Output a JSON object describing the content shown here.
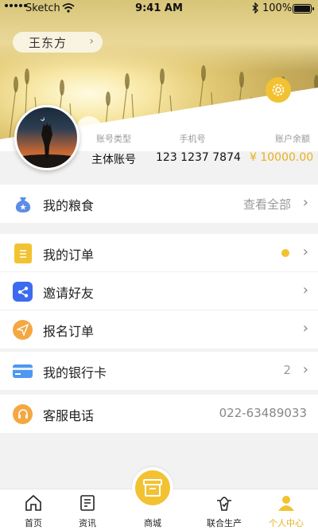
{
  "status_bar": {
    "carrier": "Sketch",
    "time": "9:41 AM",
    "battery": "100%"
  },
  "profile": {
    "name": "王东方"
  },
  "stats": [
    {
      "label": "账号类型",
      "value": "主体账号"
    },
    {
      "label": "手机号",
      "value": "123 1237 7874"
    },
    {
      "label": "账户余额",
      "value": "¥ 10000.00"
    }
  ],
  "menu": {
    "grain": {
      "label": "我的粮食",
      "action": "查看全部"
    },
    "orders": {
      "label": "我的订单"
    },
    "invite": {
      "label": "邀请好友"
    },
    "signup_orders": {
      "label": "报名订单"
    },
    "bank_card": {
      "label": "我的银行卡",
      "count": "2"
    },
    "service": {
      "label": "客服电话",
      "phone": "022-63489033"
    }
  },
  "tabs": [
    {
      "label": "首页",
      "icon": "home-icon"
    },
    {
      "label": "资讯",
      "icon": "news-icon"
    },
    {
      "label": "商城",
      "icon": "shop-icon"
    },
    {
      "label": "联合生产",
      "icon": "production-icon"
    },
    {
      "label": "个人中心",
      "icon": "profile-icon"
    }
  ],
  "colors": {
    "accent": "#f2c232",
    "money": "#e8b01e",
    "invite": "#3d6bf0",
    "bank": "#4e97f2",
    "grain": "#5b8de8"
  }
}
